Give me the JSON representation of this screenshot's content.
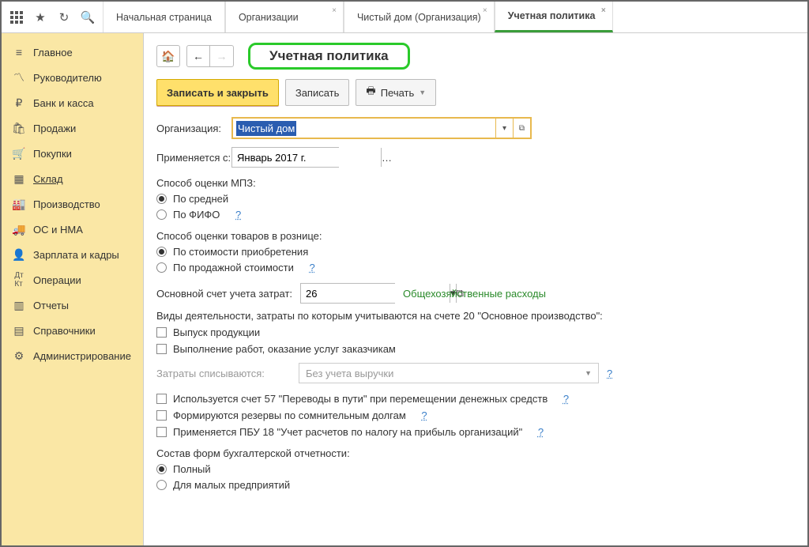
{
  "tabs": {
    "home": "Начальная страница",
    "org": "Организации",
    "clean": "Чистый дом (Организация)",
    "policy": "Учетная политика"
  },
  "sidebar": {
    "items": [
      {
        "icon": "≡",
        "label": "Главное"
      },
      {
        "icon": "📈",
        "label": "Руководителю"
      },
      {
        "icon": "₽",
        "label": "Банк и касса"
      },
      {
        "icon": "🛍",
        "label": "Продажи"
      },
      {
        "icon": "🛒",
        "label": "Покупки"
      },
      {
        "icon": "▦",
        "label": "Склад"
      },
      {
        "icon": "🏭",
        "label": "Производство"
      },
      {
        "icon": "🚚",
        "label": "ОС и НМА"
      },
      {
        "icon": "👤",
        "label": "Зарплата и кадры"
      },
      {
        "icon": "ᵀᴬ",
        "label": "Операции"
      },
      {
        "icon": "📊",
        "label": "Отчеты"
      },
      {
        "icon": "📋",
        "label": "Справочники"
      },
      {
        "icon": "⚙",
        "label": "Администрирование"
      }
    ]
  },
  "page": {
    "title": "Учетная политика",
    "save_close": "Записать и закрыть",
    "save": "Записать",
    "print": "Печать"
  },
  "form": {
    "org_label": "Организация:",
    "org_value": "Чистый дом",
    "date_label": "Применяется с:",
    "date_value": "Январь 2017 г.",
    "mpz_label": "Способ оценки МПЗ:",
    "mpz_avg": "По средней",
    "mpz_fifo": "По ФИФО",
    "retail_label": "Способ оценки товаров в рознице:",
    "retail_cost": "По стоимости приобретения",
    "retail_sale": "По продажной стоимости",
    "acc_label": "Основной счет учета затрат:",
    "acc_value": "26",
    "acc_link": "Общехозяйственные расходы",
    "activity_label": "Виды деятельности, затраты по которым учитываются на счете 20 \"Основное производство\":",
    "chk_release": "Выпуск продукции",
    "chk_works": "Выполнение работ, оказание услуг заказчикам",
    "writeoff_label": "Затраты списываются:",
    "writeoff_value": "Без учета выручки",
    "chk_acc57": "Используется счет 57 \"Переводы в пути\" при перемещении денежных средств",
    "chk_reserve": "Формируются резервы по сомнительным долгам",
    "chk_pbu18": "Применяется ПБУ 18 \"Учет расчетов по налогу на прибыль организаций\"",
    "report_label": "Состав форм бухгалтерской отчетности:",
    "report_full": "Полный",
    "report_small": "Для малых предприятий"
  },
  "help": "?"
}
